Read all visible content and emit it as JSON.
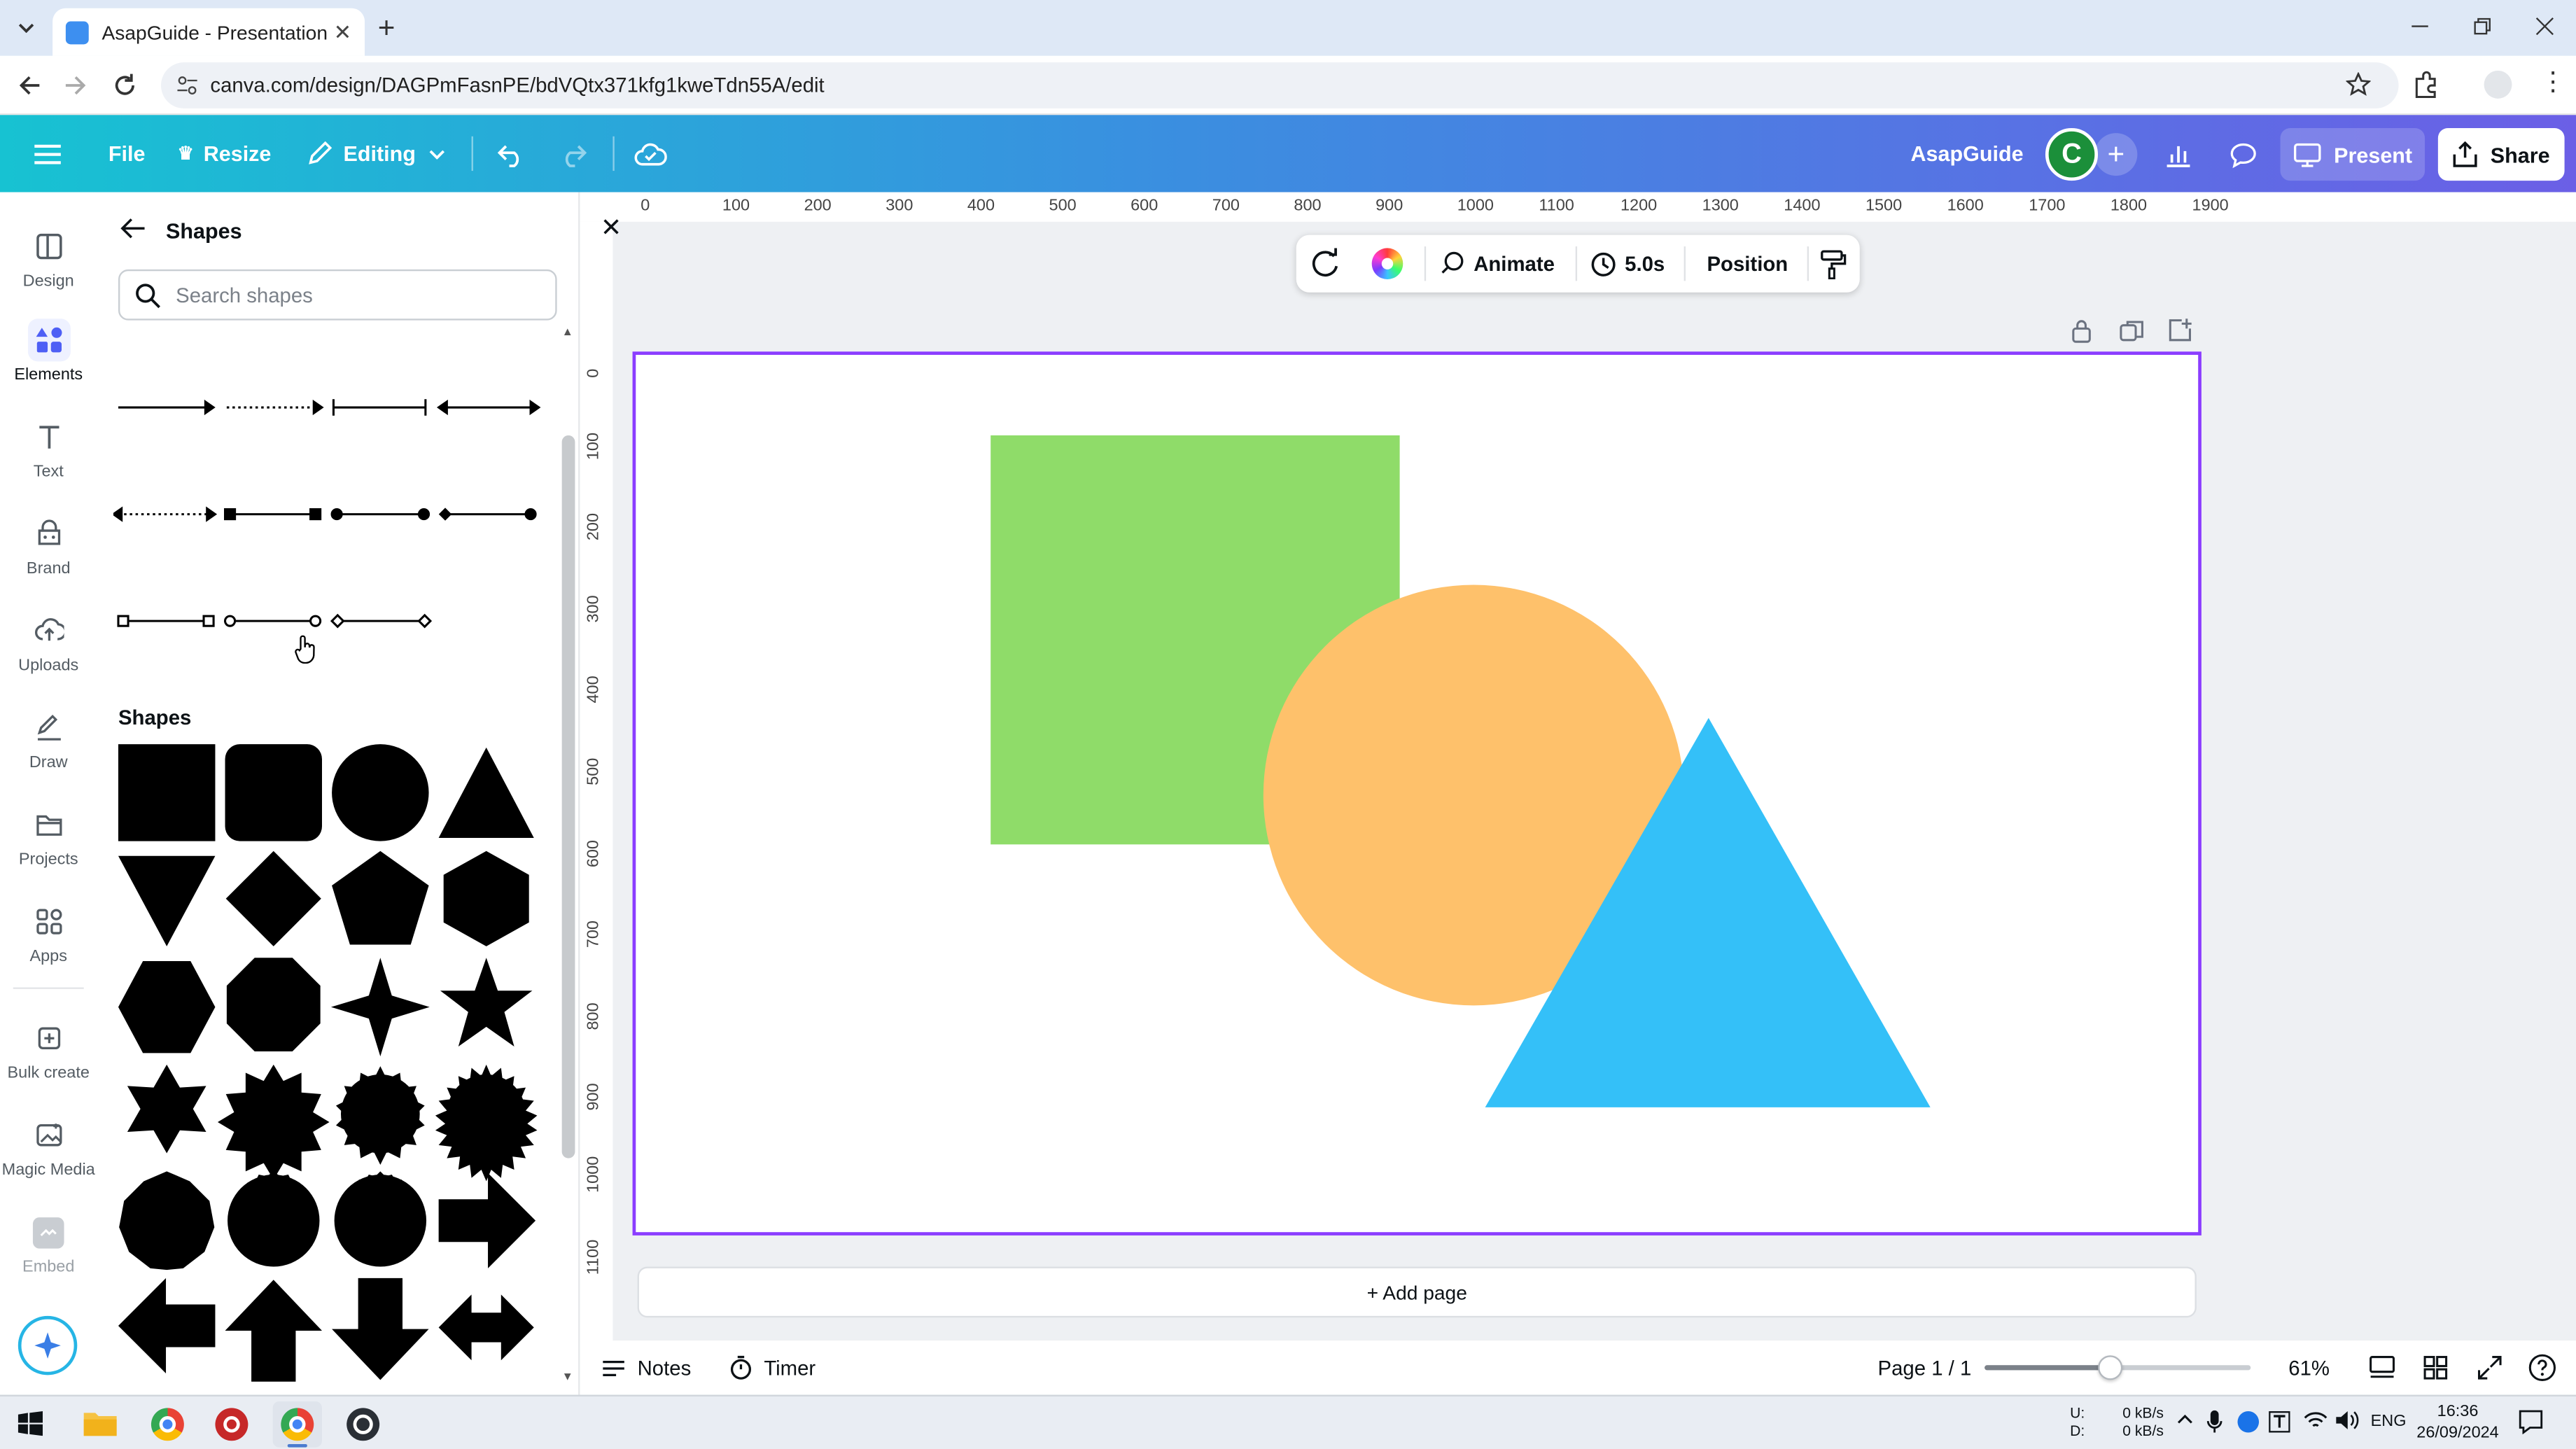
{
  "browser": {
    "tab_title": "AsapGuide - Presentation",
    "url": "canva.com/design/DAGPmFasnPE/bdVQtx371kfg1kweTdn55A/edit"
  },
  "toolbar": {
    "file_label": "File",
    "resize_label": "Resize",
    "editing_label": "Editing",
    "brand_name": "AsapGuide",
    "avatar_letter": "C",
    "present_label": "Present",
    "share_label": "Share"
  },
  "rail": {
    "items": [
      {
        "label": "Design",
        "icon": "design-icon"
      },
      {
        "label": "Elements",
        "icon": "elements-icon"
      },
      {
        "label": "Text",
        "icon": "text-icon"
      },
      {
        "label": "Brand",
        "icon": "brand-icon"
      },
      {
        "label": "Uploads",
        "icon": "uploads-icon"
      },
      {
        "label": "Draw",
        "icon": "draw-icon"
      },
      {
        "label": "Projects",
        "icon": "projects-icon"
      },
      {
        "label": "Apps",
        "icon": "apps-icon"
      },
      {
        "label": "Bulk create",
        "icon": "bulk-create-icon"
      },
      {
        "label": "Magic Media",
        "icon": "magic-media-icon"
      },
      {
        "label": "Embed",
        "icon": "embed-icon"
      }
    ]
  },
  "panel": {
    "title": "Shapes",
    "search_placeholder": "Search shapes",
    "section_title": "Shapes"
  },
  "context_bar": {
    "animate_label": "Animate",
    "duration": "5.0s",
    "position_label": "Position"
  },
  "rulers": {
    "top": [
      "0",
      "100",
      "200",
      "300",
      "400",
      "500",
      "600",
      "700",
      "800",
      "900",
      "1000",
      "1100",
      "1200",
      "1300",
      "1400",
      "1500",
      "1600",
      "1700",
      "1800",
      "1900"
    ],
    "left": [
      "0",
      "100",
      "200",
      "300",
      "400",
      "500",
      "600",
      "700",
      "800",
      "900",
      "1000",
      "1100"
    ]
  },
  "canvas": {
    "add_page_label": "+ Add page",
    "colors": {
      "square": "#8fdc69",
      "circle": "#fec16b",
      "triangle": "#34c0f8",
      "page_border": "#8b3dff"
    }
  },
  "bottom": {
    "notes_label": "Notes",
    "timer_label": "Timer",
    "page_indicator": "Page 1 / 1",
    "zoom": "61%",
    "zoom_fraction": 0.47
  },
  "taskbar": {
    "net_up_label": "U:",
    "net_down_label": "D:",
    "net_up": "0 kB/s",
    "net_down": "0 kB/s",
    "lang": "ENG",
    "time": "16:36",
    "date": "26/09/2024"
  }
}
